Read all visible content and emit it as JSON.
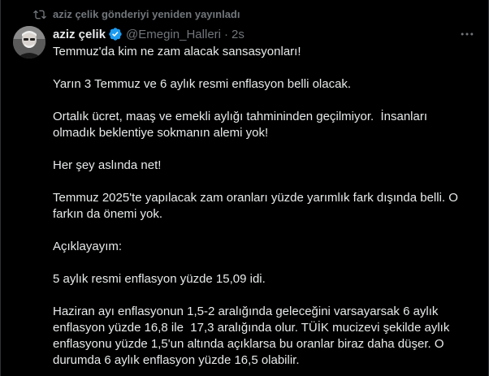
{
  "repost": {
    "icon": "repost-icon",
    "text": "aziz çelik gönderiyi yeniden yayınladı"
  },
  "author": {
    "name": "aziz çelik",
    "verified_icon": "verified-badge-icon",
    "handle": "@Emegin_Halleri",
    "separator": "·",
    "time": "2s"
  },
  "more_icon": "more-options-icon",
  "paragraphs": [
    "Temmuz'da kim ne zam alacak sansasyonları!",
    "Yarın 3 Temmuz ve 6 aylık resmi enflasyon belli olacak.",
    "Ortalık ücret, maaş ve emekli aylığı tahmininden geçilmiyor.  İnsanları olmadık beklentiye sokmanın alemi yok!",
    "Her şey aslında net!",
    "Temmuz 2025'te yapılacak zam oranları yüzde yarımlık fark dışında belli. O farkın da önemi yok.",
    "Açıklayayım:",
    "5 aylık resmi enflasyon yüzde 15,09 idi.",
    "Haziran ayı enflasyonun 1,5-2 aralığında geleceğini varsayarsak 6 aylık enflasyon yüzde 16,8 ile  17,3 aralığında olur. TÜİK mucizevi şekilde aylık enflasyonu yüzde 1,5'un altında açıklarsa bu oranlar biraz daha düşer. O durumda 6 aylık enflasyon yüzde 16,5 olabilir."
  ],
  "colors": {
    "background": "#000000",
    "text": "#e7e9ea",
    "muted": "#71767b",
    "verified": "#1d9bf0"
  }
}
